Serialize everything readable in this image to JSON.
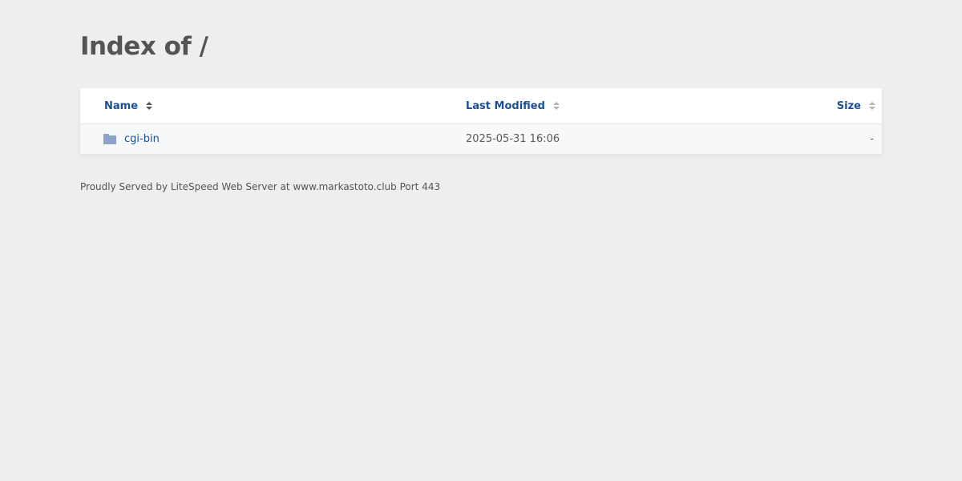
{
  "title": "Index of /",
  "columns": {
    "name": "Name",
    "modified": "Last Modified",
    "size": "Size"
  },
  "rows": [
    {
      "name": "cgi-bin",
      "modified": "2025-05-31 16:06",
      "size": "-",
      "icon": "folder-icon"
    }
  ],
  "footer": "Proudly Served by LiteSpeed Web Server at www.markastoto.club Port 443",
  "colors": {
    "background": "#edeef0",
    "link": "#1b4f93",
    "folder": "#8aa3c6"
  }
}
